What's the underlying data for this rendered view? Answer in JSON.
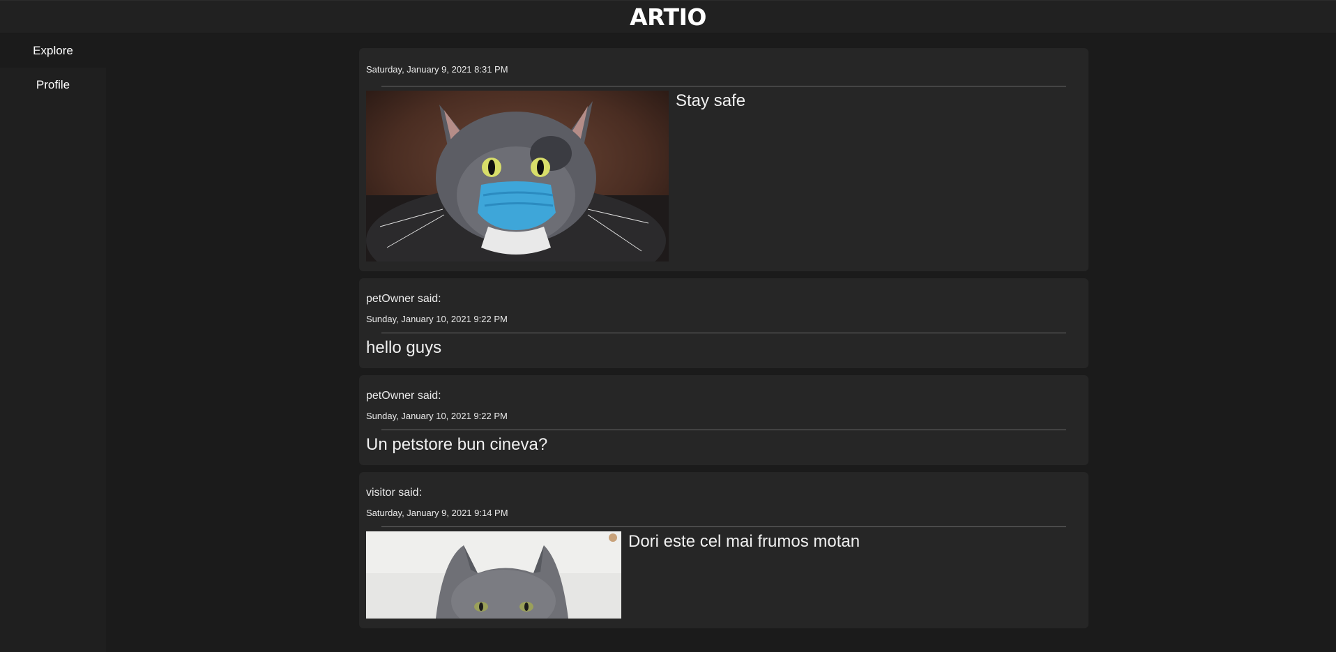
{
  "app": {
    "title": "ARTIO"
  },
  "sidebar": {
    "items": [
      {
        "label": "Explore"
      },
      {
        "label": "Profile"
      }
    ]
  },
  "posts": [
    {
      "author": "",
      "date": "Saturday, January 9, 2021 8:31 PM",
      "text": "Stay safe",
      "image": "cat-wearing-mask-photo"
    },
    {
      "author": "petOwner said:",
      "date": "Sunday, January 10, 2021 9:22 PM",
      "text": "hello guys"
    },
    {
      "author": "petOwner said:",
      "date": "Sunday, January 10, 2021 9:22 PM",
      "text": "Un petstore bun cineva?"
    },
    {
      "author": "visitor said:",
      "date": "Saturday, January 9, 2021 9:14 PM",
      "text": "Dori este cel mai frumos motan",
      "image": "gray-cat-photo"
    }
  ]
}
